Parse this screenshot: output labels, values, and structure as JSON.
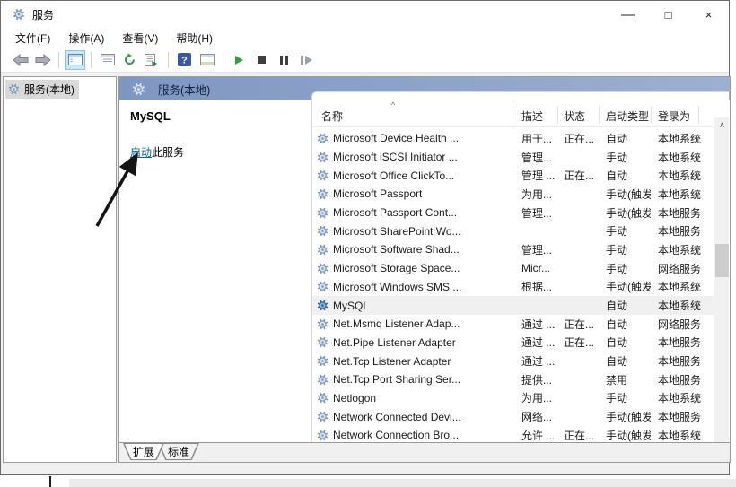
{
  "window": {
    "title": "服务",
    "controls": {
      "minimize": "—",
      "maximize": "□",
      "close": "×"
    }
  },
  "menu": {
    "items": [
      {
        "label": "文件(F)"
      },
      {
        "label": "操作(A)"
      },
      {
        "label": "查看(V)"
      },
      {
        "label": "帮助(H)"
      }
    ]
  },
  "toolbar": {
    "icons": [
      "back-icon",
      "forward-icon",
      "show-console-tree-icon",
      "properties-icon",
      "refresh-icon",
      "export-list-icon",
      "help-icon",
      "extended-view-icon",
      "start-service-icon",
      "stop-service-icon",
      "pause-service-icon",
      "restart-service-icon"
    ]
  },
  "tree": {
    "root_label": "服务(本地)"
  },
  "main": {
    "header_label": "服务(本地)",
    "pane": {
      "service_name": "MySQL",
      "action_link": "启动",
      "action_rest": "此服务"
    }
  },
  "table": {
    "columns": [
      "名称",
      "描述",
      "状态",
      "启动类型",
      "登录为"
    ],
    "sort_indicator": "^",
    "rows": [
      {
        "name": "Microsoft Device Health ...",
        "desc": "用于...",
        "status": "正在...",
        "startup": "自动",
        "logon": "本地系统",
        "selected": false
      },
      {
        "name": "Microsoft iSCSI Initiator ...",
        "desc": "管理...",
        "status": "",
        "startup": "手动",
        "logon": "本地系统",
        "selected": false
      },
      {
        "name": "Microsoft Office ClickTo...",
        "desc": "管理 ...",
        "status": "正在...",
        "startup": "自动",
        "logon": "本地系统",
        "selected": false
      },
      {
        "name": "Microsoft Passport",
        "desc": "为用...",
        "status": "",
        "startup": "手动(触发...",
        "logon": "本地系统",
        "selected": false
      },
      {
        "name": "Microsoft Passport Cont...",
        "desc": "管理...",
        "status": "",
        "startup": "手动(触发...",
        "logon": "本地服务",
        "selected": false
      },
      {
        "name": "Microsoft SharePoint Wo...",
        "desc": "",
        "status": "",
        "startup": "手动",
        "logon": "本地服务",
        "selected": false
      },
      {
        "name": "Microsoft Software Shad...",
        "desc": "管理...",
        "status": "",
        "startup": "手动",
        "logon": "本地系统",
        "selected": false
      },
      {
        "name": "Microsoft Storage Space...",
        "desc": "Micr...",
        "status": "",
        "startup": "手动",
        "logon": "网络服务",
        "selected": false
      },
      {
        "name": "Microsoft Windows SMS ...",
        "desc": "根据...",
        "status": "",
        "startup": "手动(触发...",
        "logon": "本地系统",
        "selected": false
      },
      {
        "name": "MySQL",
        "desc": "",
        "status": "",
        "startup": "自动",
        "logon": "本地系统",
        "selected": true
      },
      {
        "name": "Net.Msmq Listener Adap...",
        "desc": "通过 ...",
        "status": "正在...",
        "startup": "自动",
        "logon": "网络服务",
        "selected": false
      },
      {
        "name": "Net.Pipe Listener Adapter",
        "desc": "通过 ...",
        "status": "正在...",
        "startup": "自动",
        "logon": "本地服务",
        "selected": false
      },
      {
        "name": "Net.Tcp Listener Adapter",
        "desc": "通过 ...",
        "status": "",
        "startup": "自动",
        "logon": "本地服务",
        "selected": false
      },
      {
        "name": "Net.Tcp Port Sharing Ser...",
        "desc": "提供...",
        "status": "",
        "startup": "禁用",
        "logon": "本地服务",
        "selected": false
      },
      {
        "name": "Netlogon",
        "desc": "为用...",
        "status": "",
        "startup": "手动",
        "logon": "本地系统",
        "selected": false
      },
      {
        "name": "Network Connected Devi...",
        "desc": "网络...",
        "status": "",
        "startup": "手动(触发...",
        "logon": "本地服务",
        "selected": false
      },
      {
        "name": "Network Connection Bro...",
        "desc": "允许 ...",
        "status": "正在...",
        "startup": "手动(触发...",
        "logon": "本地系统",
        "selected": false
      }
    ]
  },
  "tabs": {
    "extended": "扩展",
    "standard": "标准"
  },
  "colors": {
    "header_band_start": "#7e97c1",
    "header_band_end": "#9db0d2",
    "link": "#0563c1",
    "selected_row_bg": "#f0f0f0",
    "help_icon_bg": "#3a57a5",
    "start_icon_green": "#2fa03a",
    "gear_normal": "#7d97b8",
    "gear_selected": "#2e5f9b"
  }
}
